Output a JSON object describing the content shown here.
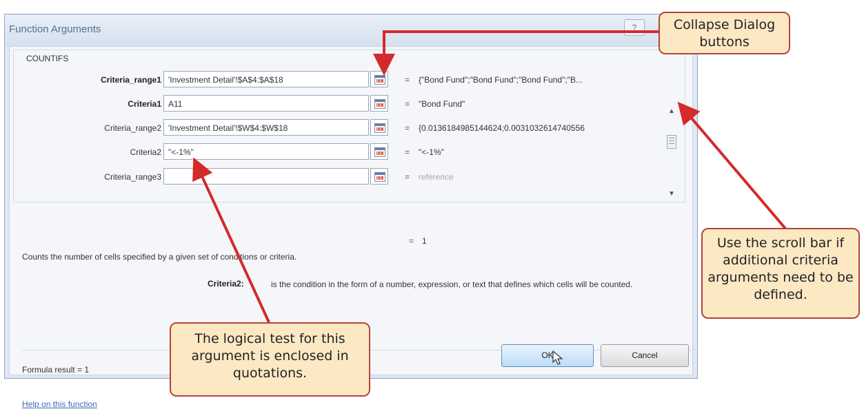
{
  "dialog": {
    "title": "Function Arguments",
    "help_button": "?",
    "function_name": "COUNTIFS",
    "arguments": [
      {
        "label": "Criteria_range1",
        "bold": true,
        "value": "'Investment Detail'!$A$4:$A$18",
        "result": "{\"Bond Fund\";\"Bond Fund\";\"Bond Fund\";\"B...",
        "result_gray": false
      },
      {
        "label": "Criteria1",
        "bold": true,
        "value": "A11",
        "result": "\"Bond Fund\"",
        "result_gray": false
      },
      {
        "label": "Criteria_range2",
        "bold": false,
        "value": "'Investment Detail'!$W$4:$W$18",
        "result": "{0.0136184985144624;0.0031032614740556",
        "result_gray": false
      },
      {
        "label": "Criteria2",
        "bold": false,
        "value": "\"<-1%\"",
        "result": "\"<-1%\"",
        "result_gray": false
      },
      {
        "label": "Criteria_range3",
        "bold": false,
        "value": "",
        "result": "reference",
        "result_gray": true
      }
    ],
    "equals": "=",
    "function_result": "1",
    "description": "Counts the number of cells specified by a given set of conditions or criteria.",
    "arg_desc_name": "Criteria2:",
    "arg_desc_text": "is the condition in the form of a number, expression, or text that defines which cells will be counted.",
    "formula_result": "Formula result =   1",
    "help_link": "Help on this function",
    "ok_label": "OK",
    "cancel_label": "Cancel"
  },
  "callouts": {
    "collapse": "Collapse Dialog buttons",
    "scroll": "Use the scroll bar if additional criteria arguments need to be defined.",
    "quotes": "The logical test for this argument is enclosed in quotations."
  },
  "colors": {
    "callout_fill": "#fde8c4",
    "callout_border": "#b14538",
    "arrow": "#d42a2a"
  }
}
